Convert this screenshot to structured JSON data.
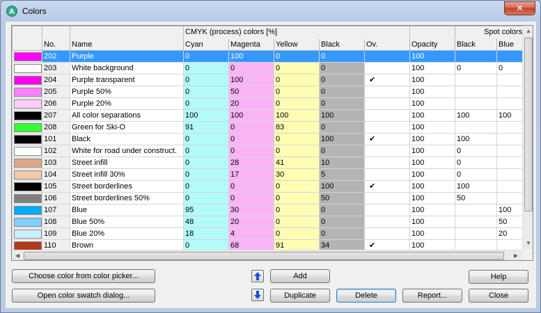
{
  "window": {
    "title": "Colors"
  },
  "table": {
    "group_headers": {
      "cmyk": "CMYK (process) colors [%]",
      "spot": "Spot colors [%]"
    },
    "columns": [
      "No.",
      "Name",
      "Cyan",
      "Magenta",
      "Yellow",
      "Black",
      "Ov.",
      "Opacity",
      "Black",
      "Blue"
    ],
    "rows": [
      {
        "swatch": "#ff00ff",
        "no": "202",
        "name": "Purple",
        "cyan": "0",
        "magenta": "100",
        "yellow": "0",
        "black": "0",
        "ov": "",
        "opacity": "100",
        "spot_black": "",
        "spot_blue": "",
        "selected": true
      },
      {
        "swatch": "#ffffff",
        "no": "203",
        "name": "White background",
        "cyan": "0",
        "magenta": "0",
        "yellow": "0",
        "black": "0",
        "ov": "",
        "opacity": "100",
        "spot_black": "0",
        "spot_blue": "0"
      },
      {
        "swatch": "#ff00ee",
        "no": "204",
        "name": "Purple transparent",
        "cyan": "0",
        "magenta": "100",
        "yellow": "0",
        "black": "0",
        "ov": "✔",
        "opacity": "100",
        "spot_black": "",
        "spot_blue": ""
      },
      {
        "swatch": "#ff80ff",
        "no": "205",
        "name": "Purple 50%",
        "cyan": "0",
        "magenta": "50",
        "yellow": "0",
        "black": "0",
        "ov": "",
        "opacity": "100",
        "spot_black": "",
        "spot_blue": ""
      },
      {
        "swatch": "#ffccff",
        "no": "206",
        "name": "Purple 20%",
        "cyan": "0",
        "magenta": "20",
        "yellow": "0",
        "black": "0",
        "ov": "",
        "opacity": "100",
        "spot_black": "",
        "spot_blue": ""
      },
      {
        "swatch": "#000000",
        "no": "207",
        "name": "All color separations",
        "cyan": "100",
        "magenta": "100",
        "yellow": "100",
        "black": "100",
        "ov": "",
        "opacity": "100",
        "spot_black": "100",
        "spot_blue": "100"
      },
      {
        "swatch": "#33ff33",
        "no": "208",
        "name": "Green for Ski-O",
        "cyan": "91",
        "magenta": "0",
        "yellow": "83",
        "black": "0",
        "ov": "",
        "opacity": "100",
        "spot_black": "",
        "spot_blue": ""
      },
      {
        "swatch": "#000000",
        "no": "101",
        "name": "Black",
        "cyan": "0",
        "magenta": "0",
        "yellow": "0",
        "black": "100",
        "ov": "✔",
        "opacity": "100",
        "spot_black": "100",
        "spot_blue": ""
      },
      {
        "swatch": "#ffffff",
        "no": "102",
        "name": "White for road under construct.",
        "cyan": "0",
        "magenta": "0",
        "yellow": "0",
        "black": "0",
        "ov": "",
        "opacity": "100",
        "spot_black": "0",
        "spot_blue": ""
      },
      {
        "swatch": "#e0a88a",
        "no": "103",
        "name": "Street infill",
        "cyan": "0",
        "magenta": "28",
        "yellow": "41",
        "black": "10",
        "ov": "",
        "opacity": "100",
        "spot_black": "0",
        "spot_blue": ""
      },
      {
        "swatch": "#f2c9aa",
        "no": "104",
        "name": "Street infill 30%",
        "cyan": "0",
        "magenta": "17",
        "yellow": "30",
        "black": "5",
        "ov": "",
        "opacity": "100",
        "spot_black": "0",
        "spot_blue": ""
      },
      {
        "swatch": "#000000",
        "no": "105",
        "name": "Street borderlines",
        "cyan": "0",
        "magenta": "0",
        "yellow": "0",
        "black": "100",
        "ov": "✔",
        "opacity": "100",
        "spot_black": "100",
        "spot_blue": ""
      },
      {
        "swatch": "#808080",
        "no": "106",
        "name": "Street borderlines 50%",
        "cyan": "0",
        "magenta": "0",
        "yellow": "0",
        "black": "50",
        "ov": "",
        "opacity": "100",
        "spot_black": "50",
        "spot_blue": ""
      },
      {
        "swatch": "#00aaff",
        "no": "107",
        "name": "Blue",
        "cyan": "95",
        "magenta": "30",
        "yellow": "0",
        "black": "0",
        "ov": "",
        "opacity": "100",
        "spot_black": "",
        "spot_blue": "100"
      },
      {
        "swatch": "#80d0ff",
        "no": "108",
        "name": "Blue 50%",
        "cyan": "48",
        "magenta": "20",
        "yellow": "0",
        "black": "0",
        "ov": "",
        "opacity": "100",
        "spot_black": "",
        "spot_blue": "50"
      },
      {
        "swatch": "#ccefff",
        "no": "109",
        "name": "Blue 20%",
        "cyan": "18",
        "magenta": "4",
        "yellow": "0",
        "black": "0",
        "ov": "",
        "opacity": "100",
        "spot_black": "",
        "spot_blue": "20"
      },
      {
        "swatch": "#b03a1a",
        "no": "110",
        "name": "Brown",
        "cyan": "0",
        "magenta": "68",
        "yellow": "91",
        "black": "34",
        "ov": "✔",
        "opacity": "100",
        "spot_black": "",
        "spot_blue": ""
      }
    ]
  },
  "buttons": {
    "choose_picker": "Choose color from color picker...",
    "open_swatch": "Open color swatch dialog...",
    "add": "Add",
    "duplicate": "Duplicate",
    "delete": "Delete",
    "report": "Report...",
    "help": "Help",
    "close": "Close"
  },
  "icons": {
    "app": "app-logo-icon",
    "close": "close-icon",
    "move_up": "arrow-up-icon",
    "move_down": "arrow-down-icon"
  },
  "colors": {
    "selection": "#3399ff",
    "cyan": "#b3fbfb",
    "magenta": "#fab4f6",
    "yellow": "#fdfdb4",
    "black": "#b4b4b4"
  }
}
